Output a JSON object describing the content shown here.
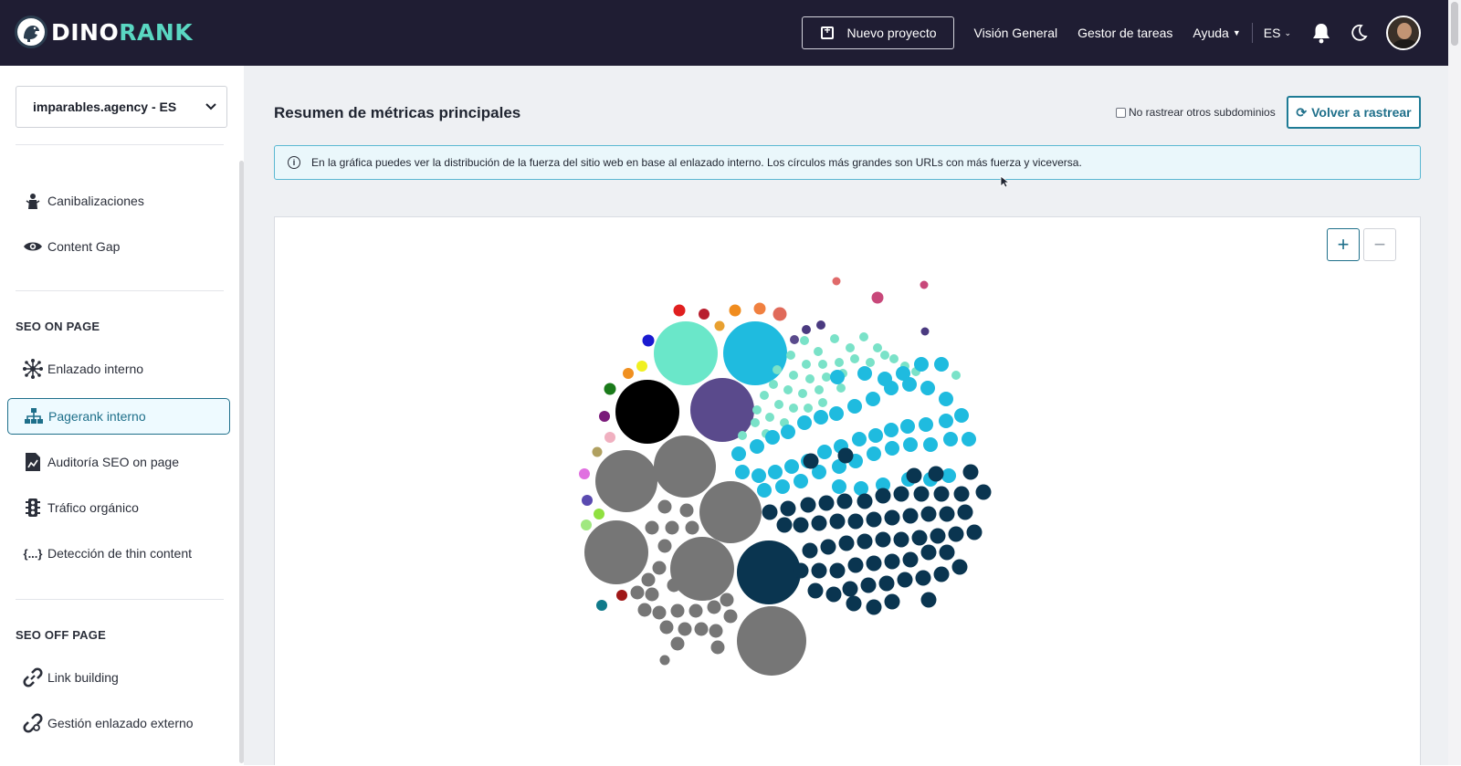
{
  "header": {
    "logo_dino": "DINO",
    "logo_rank": "RANK",
    "new_project_label": "Nuevo proyecto",
    "overview_label": "Visión General",
    "tasks_label": "Gestor de tareas",
    "help_label": "Ayuda",
    "language_label": "ES"
  },
  "sidebar": {
    "project": "imparables.agency - ES",
    "items_top": [
      {
        "label": "Canibalizaciones",
        "icon": "cannibal-icon"
      },
      {
        "label": "Content Gap",
        "icon": "eye-icon"
      }
    ],
    "section_on_page": "SEO ON PAGE",
    "items_on_page": [
      {
        "label": "Enlazado interno",
        "icon": "network-icon"
      },
      {
        "label": "Pagerank interno",
        "icon": "hierarchy-icon",
        "active": true
      },
      {
        "label": "Auditoría SEO on page",
        "icon": "file-chart-icon"
      },
      {
        "label": "Tráfico orgánico",
        "icon": "traffic-light-icon"
      },
      {
        "label": "Detección de thin content",
        "icon": "braces-icon",
        "icon_text": "{...}"
      }
    ],
    "section_off_page": "SEO OFF PAGE",
    "items_off_page": [
      {
        "label": "Link building",
        "icon": "link-icon"
      },
      {
        "label": "Gestión enlazado externo",
        "icon": "external-link-icon"
      }
    ]
  },
  "main": {
    "title": "Resumen de métricas principales",
    "checkbox_label": "No rastrear otros subdominios",
    "checkbox_checked": false,
    "recrawl_label": "Volver a rastrear",
    "info_text": "En la gráfica puedes ver la distribución de la fuerza del sitio web en base al enlazado interno. Los círculos más grandes son URLs con más fuerza y viceversa.",
    "zoom_in_label": "+",
    "zoom_out_label": "−"
  },
  "colors": {
    "topbar": "#1f1d33",
    "accent": "#1e6f8a",
    "mint": "#6ae7c9",
    "cyan": "#1fbbdf",
    "navy": "#0a3550",
    "gray": "#767676",
    "purple": "#5a4a8c"
  }
}
